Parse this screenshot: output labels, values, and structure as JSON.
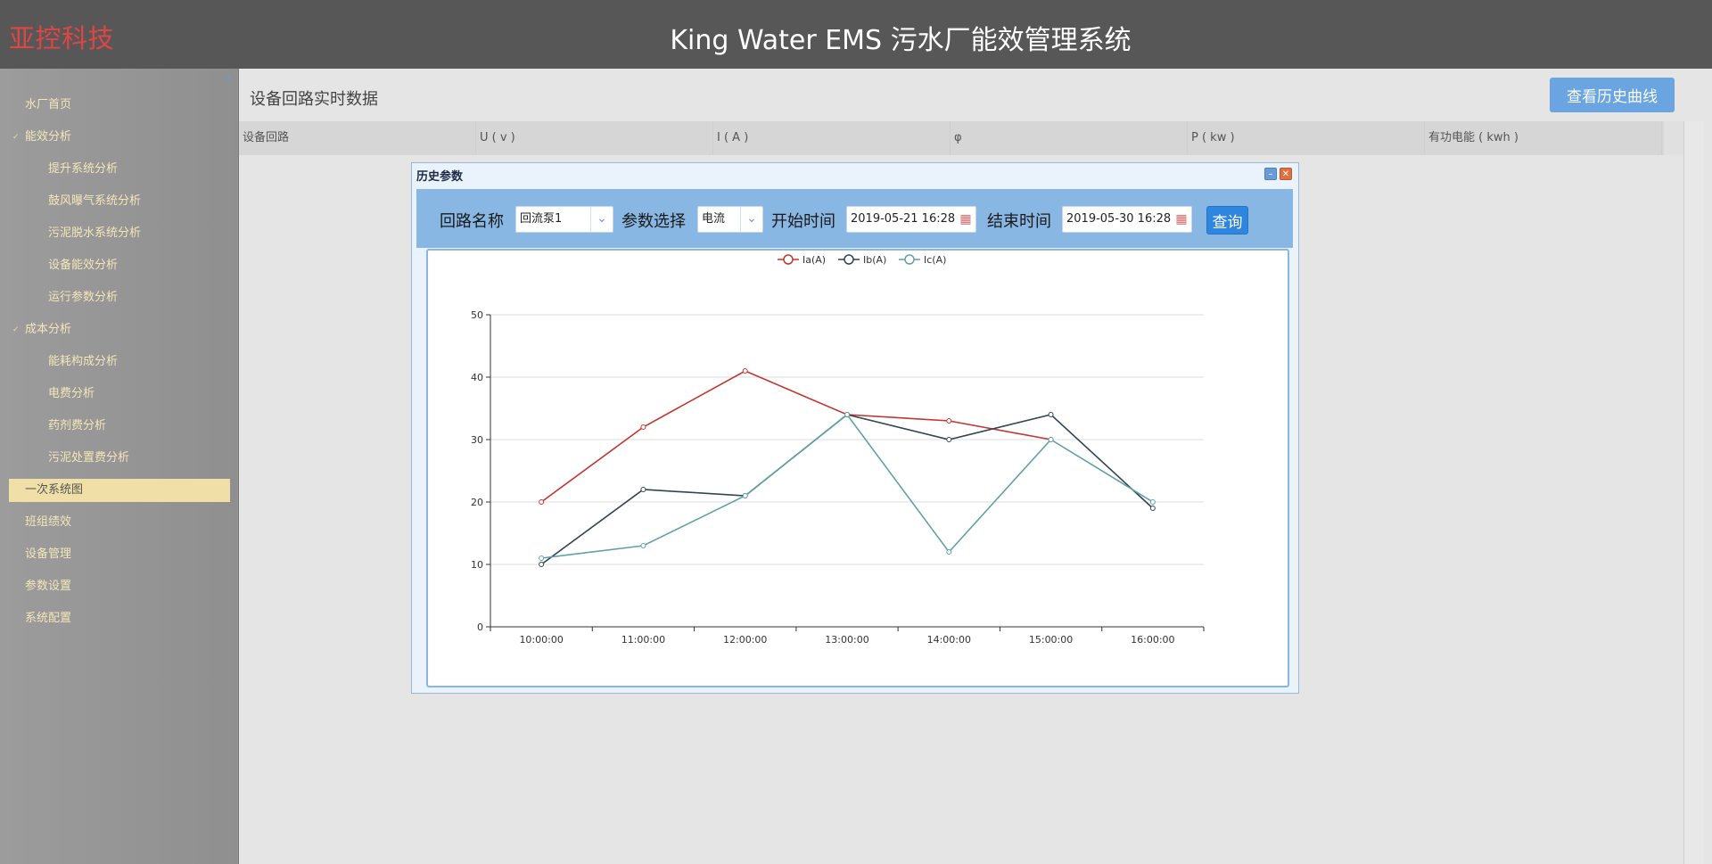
{
  "header": {
    "brand": "亚控科技",
    "title": "King Water EMS 污水厂能效管理系统"
  },
  "sidebar": {
    "items": [
      {
        "label": "水厂首页",
        "level": 1,
        "expanded": false
      },
      {
        "label": "能效分析",
        "level": 1,
        "expanded": true
      },
      {
        "label": "提升系统分析",
        "level": 2
      },
      {
        "label": "鼓风曝气系统分析",
        "level": 2
      },
      {
        "label": "污泥脱水系统分析",
        "level": 2
      },
      {
        "label": "设备能效分析",
        "level": 2
      },
      {
        "label": "运行参数分析",
        "level": 2
      },
      {
        "label": "成本分析",
        "level": 1,
        "expanded": true
      },
      {
        "label": "能耗构成分析",
        "level": 2
      },
      {
        "label": "电费分析",
        "level": 2
      },
      {
        "label": "药剂费分析",
        "level": 2
      },
      {
        "label": "污泥处置费分析",
        "level": 2
      },
      {
        "label": "一次系统图",
        "level": 1,
        "active": true
      },
      {
        "label": "班组绩效",
        "level": 1
      },
      {
        "label": "设备管理",
        "level": 1
      },
      {
        "label": "参数设置",
        "level": 1
      },
      {
        "label": "系统配置",
        "level": 1
      }
    ]
  },
  "main": {
    "title": "设备回路实时数据",
    "history_button": "查看历史曲线",
    "columns": [
      "设备回路",
      "U ( v )",
      "I ( A )",
      "φ",
      "P ( kw )",
      "有功电能 ( kwh )"
    ]
  },
  "dialog": {
    "title": "历史参数",
    "circuit_label": "回路名称",
    "circuit_value": "回流泵1",
    "param_label": "参数选择",
    "param_value": "电流",
    "start_label": "开始时间",
    "start_value": "2019-05-21 16:28",
    "end_label": "结束时间",
    "end_value": "2019-05-30 16:28",
    "query_button": "查询"
  },
  "colors": {
    "header_bg": "#575757",
    "brand": "#e04545",
    "active_nav": "#f0e0a8",
    "toolbar": "#88b7e4",
    "query_button": "#2f86de",
    "history_button": "#6aa5e2"
  },
  "chart_data": {
    "type": "line",
    "x": [
      "10:00:00",
      "11:00:00",
      "12:00:00",
      "13:00:00",
      "14:00:00",
      "15:00:00",
      "16:00:00"
    ],
    "ylim": [
      0,
      50
    ],
    "yticks": [
      0,
      10,
      20,
      30,
      40,
      50
    ],
    "legend_position": "top-center",
    "grid": true,
    "series": [
      {
        "name": "Ia(A)",
        "color": "#c23531",
        "values": [
          20,
          32,
          41,
          34,
          33,
          30,
          null
        ]
      },
      {
        "name": "Ib(A)",
        "color": "#2f4554",
        "values": [
          10,
          22,
          21,
          34,
          30,
          34,
          19
        ]
      },
      {
        "name": "Ic(A)",
        "color": "#61a0a8",
        "values": [
          11,
          13,
          21,
          34,
          12,
          30,
          20
        ]
      }
    ]
  }
}
